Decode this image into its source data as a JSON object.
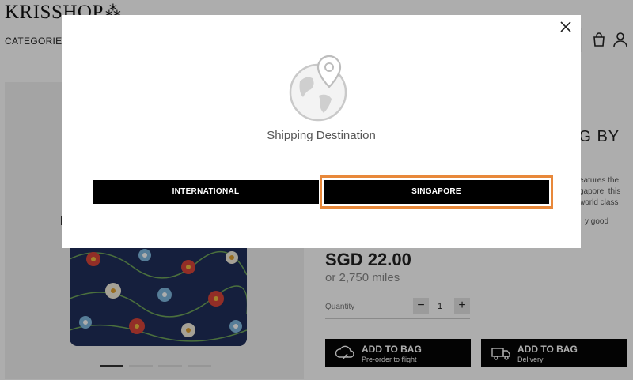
{
  "header": {
    "logo_text": "KRISSHOP",
    "categories_label": "CATEGORIES",
    "bag_icon": "shopping-bag-icon",
    "account_icon": "user-icon"
  },
  "product": {
    "title_partial": "AG BY",
    "left_partial": "l",
    "description_lines": [
      "eatures the",
      "gapore, this",
      "world class"
    ],
    "description_tail": "y good",
    "price": "SGD 22.00",
    "miles": "or 2,750 miles",
    "quantity_label": "Quantity",
    "quantity_value": "1",
    "minus_label": "−",
    "plus_label": "+",
    "cta_preorder": {
      "label": "ADD TO BAG",
      "sublabel": "Pre-order to flight"
    },
    "cta_delivery": {
      "label": "ADD TO BAG",
      "sublabel": "Delivery"
    }
  },
  "modal": {
    "title": "Shipping Destination",
    "icon": "globe-location-icon",
    "options": [
      {
        "label": "INTERNATIONAL"
      },
      {
        "label": "SINGAPORE"
      }
    ],
    "highlight_color": "#e8883a"
  }
}
